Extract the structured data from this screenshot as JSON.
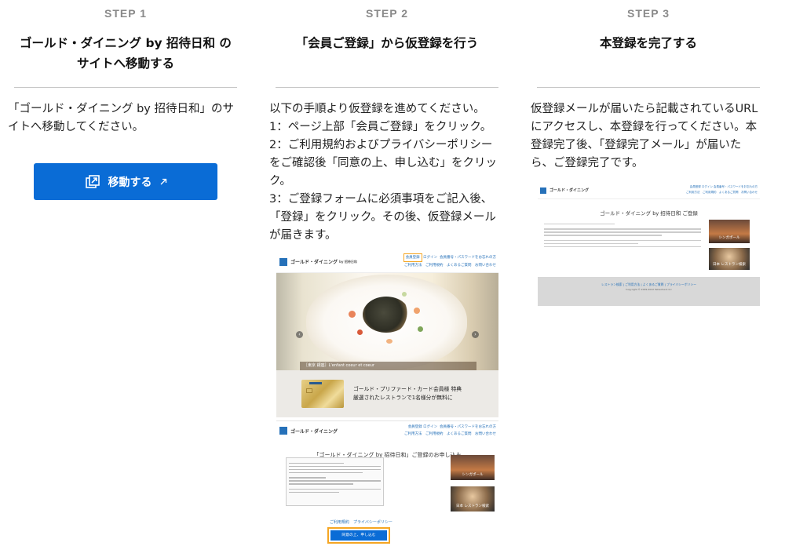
{
  "steps": [
    {
      "label": "STEP 1",
      "title_line1": "ゴールド・ダイニング by 招待日和 の",
      "title_line2": "サイトへ移動する",
      "desc_lines": [
        "「ゴールド・ダイニング by 招待日和」のサ",
        "イトへ移動してください。"
      ],
      "button_label": "移動する"
    },
    {
      "label": "STEP 2",
      "title_line1": "「会員ご登録」から仮登録を行う",
      "desc_lines": [
        "以下の手順より仮登録を進めてください。",
        "1：ページ上部「会員ご登録」をクリック。",
        "2：ご利用規約およびプライバシーポリシー",
        "をご確認後「同意の上、申し込む」をクリッ",
        "ク。",
        "3：ご登録フォームに必須事項をご記入後、",
        "「登録」をクリック。その後、仮登録メール",
        "が届きます。"
      ]
    },
    {
      "label": "STEP 3",
      "title_line1": "本登録を完了する",
      "desc_lines": [
        "仮登録メールが届いたら記載されているURL",
        "にアクセスし、本登録を行ってください。本",
        "登録完了後、「登録完了メール」が届いた",
        "ら、ご登録完了です。"
      ]
    }
  ],
  "mock_site": {
    "brand": "ゴールド・ダイニング",
    "brand_sub": "by 招待日和",
    "nav_register": "会員登録",
    "nav_login": "ログイン",
    "nav_forgot": "会員番号・パスワードをお忘れの方",
    "nav_row2": "ご利用方法　ご利用規約　よくあるご質問　お問い合わせ",
    "hero_caption": "［東京 銀座］L'enfant coeur et coeur",
    "promo_line1": "ゴールド・プリファード・カード会員様 特典",
    "promo_line2": "厳選されたレストランで1名様分が無料に",
    "form_title": "「ゴールド・ダイニング by 招待日和」ご登録のお申し込み",
    "thumb1": "シンガポール",
    "thumb2": "日本 レストラン検索",
    "links": "ご利用規約　プライバシーポリシー",
    "apply_label": "同意の上、申し込む",
    "complete_title": "ゴールド・ダイニング by 招待日和 ご登録",
    "footer_links": "レストラン検索 | ご利用方法 | よくあるご質問 | プライバシーポリシー",
    "footer_copy": "Copyright © 2009-2022 Tablecheck Inc"
  },
  "colors": {
    "button_blue": "#0a6cd6",
    "highlight_orange": "#f5a623",
    "step_gray": "#8a8a8a"
  },
  "icons": {
    "external_window": "external-window-icon",
    "arrow_ne": "arrow-up-right-icon"
  }
}
